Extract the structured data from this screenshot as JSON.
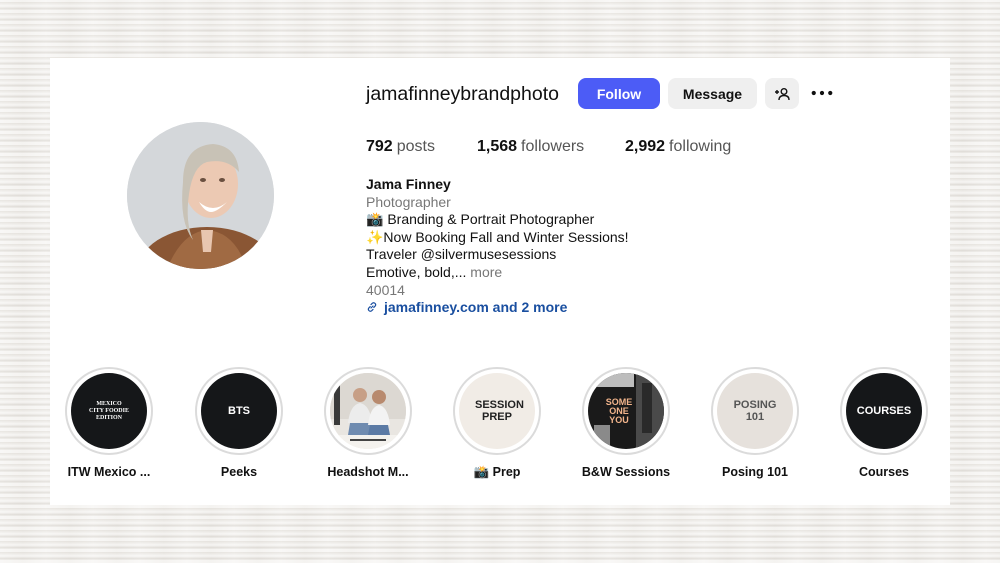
{
  "profile": {
    "username": "jamafinneybrandphoto",
    "follow_label": "Follow",
    "message_label": "Message",
    "add_user_icon": "person-add-icon",
    "more_icon": "more-dots-icon",
    "avatar_icon": "profile-photo"
  },
  "stats": {
    "posts_count": "792",
    "posts_label": "posts",
    "followers_count": "1,568",
    "followers_label": "followers",
    "following_count": "2,992",
    "following_label": "following"
  },
  "bio": {
    "name": "Jama Finney",
    "category": "Photographer",
    "line1": "📸 Branding & Portrait Photographer",
    "line2": "✨Now Booking Fall and Winter Sessions!",
    "line3": "Traveler @silvermusesessions",
    "line4": "Emotive, bold,... ",
    "more_label": "more",
    "zip": "40014",
    "link": "jamafinney.com and 2 more",
    "link_icon": "link-icon"
  },
  "highlights": [
    {
      "label": "ITW Mexico ...",
      "cover_text": "MEXICO CITY FOODIE EDITION",
      "style": "dark"
    },
    {
      "label": "Peeks",
      "cover_text": "BTS",
      "style": "dark"
    },
    {
      "label": "Headshot M...",
      "cover_text": "",
      "style": "photo"
    },
    {
      "label": "📸 Prep",
      "cover_text": "SESSION PREP",
      "style": "cream"
    },
    {
      "label": "B&W Sessions",
      "cover_text": "SOME ONE YOU",
      "style": "photo"
    },
    {
      "label": "Posing 101",
      "cover_text": "POSING 101",
      "style": "cream"
    },
    {
      "label": "Courses",
      "cover_text": "COURSES",
      "style": "dark"
    }
  ],
  "colors": {
    "accent": "#4c5cf6",
    "link": "#1a4fa0",
    "dark_cover": "#151719",
    "cream_cover": "#f1ece6"
  }
}
